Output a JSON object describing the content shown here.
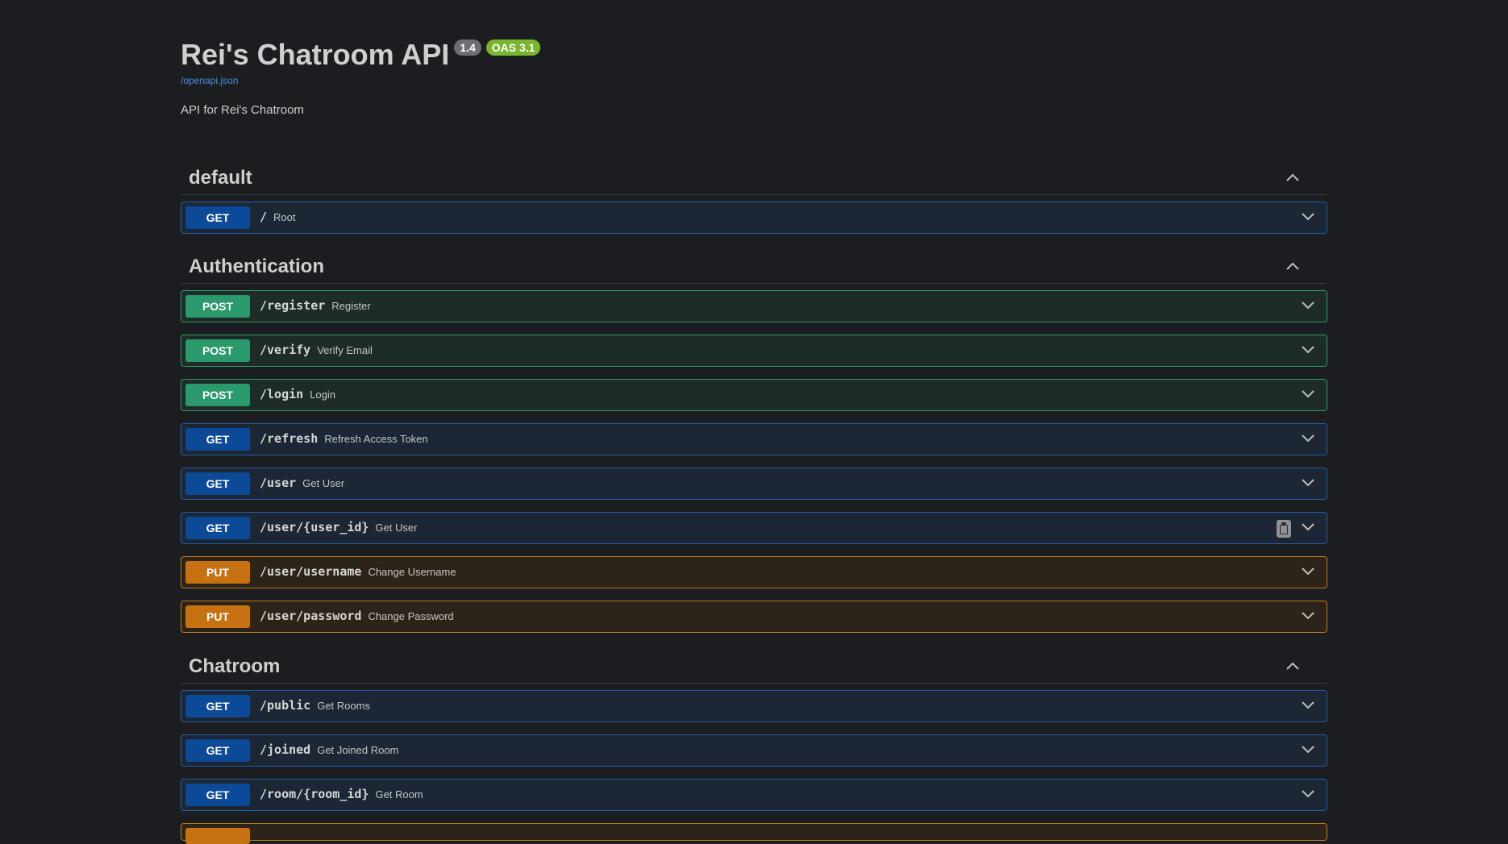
{
  "header": {
    "title": "Rei's Chatroom API",
    "version_badge": "1.4",
    "oas_badge": "OAS 3.1",
    "spec_link": "/openapi.json",
    "description": "API for Rei's Chatroom"
  },
  "sections": [
    {
      "title": "default",
      "operations": [
        {
          "method": "GET",
          "path": "/",
          "summary": "Root"
        }
      ]
    },
    {
      "title": "Authentication",
      "operations": [
        {
          "method": "POST",
          "path": "/register",
          "summary": "Register"
        },
        {
          "method": "POST",
          "path": "/verify",
          "summary": "Verify Email"
        },
        {
          "method": "POST",
          "path": "/login",
          "summary": "Login"
        },
        {
          "method": "GET",
          "path": "/refresh",
          "summary": "Refresh Access Token"
        },
        {
          "method": "GET",
          "path": "/user",
          "summary": "Get User"
        },
        {
          "method": "GET",
          "path": "/user/{user_id}",
          "summary": "Get User"
        },
        {
          "method": "PUT",
          "path": "/user/username",
          "summary": "Change Username"
        },
        {
          "method": "PUT",
          "path": "/user/password",
          "summary": "Change Password"
        }
      ]
    },
    {
      "title": "Chatroom",
      "operations": [
        {
          "method": "GET",
          "path": "/public",
          "summary": "Get Rooms"
        },
        {
          "method": "GET",
          "path": "/joined",
          "summary": "Get Joined Room"
        },
        {
          "method": "GET",
          "path": "/room/{room_id}",
          "summary": "Get Room"
        }
      ]
    }
  ],
  "colors": {
    "get": "#0c4a98",
    "post": "#2a9a6d",
    "put": "#c67213",
    "background": "#1c1d20"
  }
}
